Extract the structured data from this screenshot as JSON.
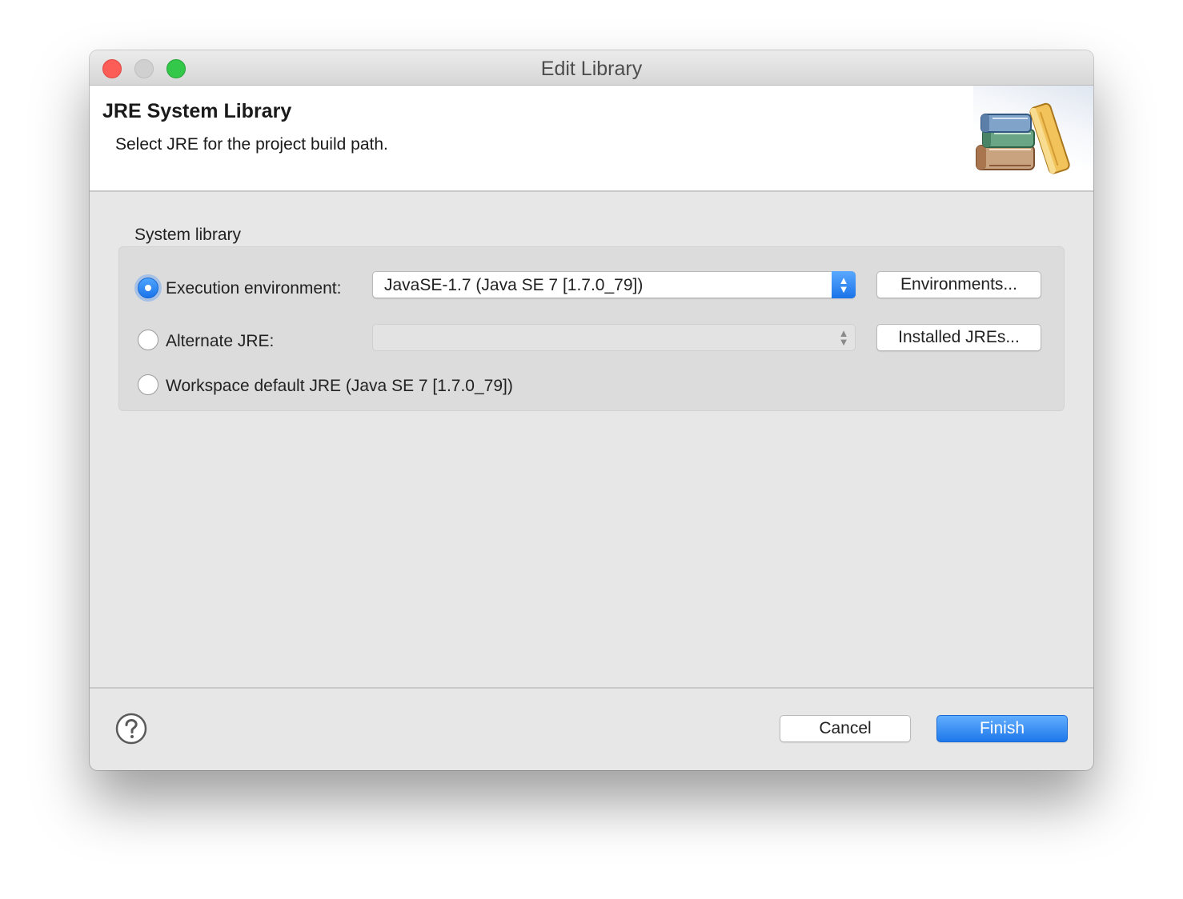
{
  "window": {
    "title": "Edit Library"
  },
  "header": {
    "title": "JRE System Library",
    "description": "Select JRE for the project build path.",
    "icon": "books-library-icon"
  },
  "system_library": {
    "group_label": "System library",
    "execution_environment": {
      "label": "Execution environment:",
      "selected": true,
      "value": "JavaSE-1.7 (Java SE 7 [1.7.0_79])",
      "button_label": "Environments..."
    },
    "alternate_jre": {
      "label": "Alternate JRE:",
      "selected": false,
      "value": "",
      "button_label": "Installed JREs..."
    },
    "workspace_default": {
      "label": "Workspace default JRE (Java SE 7 [1.7.0_79])",
      "selected": false
    }
  },
  "footer": {
    "help_icon": "help-question-icon",
    "cancel_label": "Cancel",
    "finish_label": "Finish"
  },
  "colors": {
    "accent": "#1e78ea",
    "close": "#fc5e57",
    "maximize": "#34c84a"
  }
}
